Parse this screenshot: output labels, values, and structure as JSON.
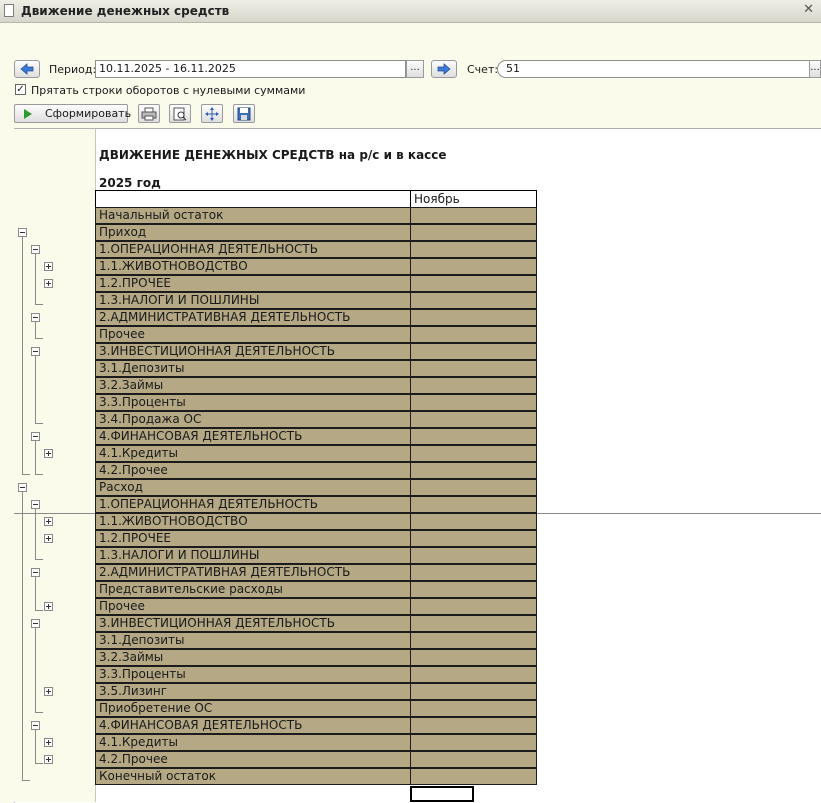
{
  "window": {
    "title": "Движение денежных средств"
  },
  "toolbar": {
    "period_label": "Период:",
    "period_value": "10.11.2025 - 16.11.2025",
    "account_label": "Счет:",
    "account_value": "51",
    "ellipsis": "...",
    "hide_zero_label": "Прятать строки оборотов с нулевыми суммами",
    "hide_zero_checked": true,
    "generate_label": "Сформировать"
  },
  "report": {
    "title": "ДВИЖЕНИЕ ДЕНЕЖНЫХ СРЕДСТВ на р/с и в кассе",
    "year": "2025 год",
    "column_header": "Ноябрь",
    "rows": [
      {
        "label": "Начальный остаток",
        "value": ""
      },
      {
        "label": "Приход",
        "value": ""
      },
      {
        "label": "1.ОПЕРАЦИОННАЯ ДЕЯТЕЛЬНОСТЬ",
        "value": ""
      },
      {
        "label": "1.1.ЖИВОТНОВОДСТВО",
        "value": ""
      },
      {
        "label": "1.2.ПРОЧЕЕ",
        "value": ""
      },
      {
        "label": "1.3.НАЛОГИ И ПОШЛИНЫ",
        "value": ""
      },
      {
        "label": "2.АДМИНИСТРАТИВНАЯ ДЕЯТЕЛЬНОСТЬ",
        "value": ""
      },
      {
        "label": "Прочее",
        "value": ""
      },
      {
        "label": "3.ИНВЕСТИЦИОННАЯ ДЕЯТЕЛЬНОСТЬ",
        "value": ""
      },
      {
        "label": "3.1.Депозиты",
        "value": ""
      },
      {
        "label": "3.2.Займы",
        "value": ""
      },
      {
        "label": "3.3.Проценты",
        "value": ""
      },
      {
        "label": "3.4.Продажа ОС",
        "value": ""
      },
      {
        "label": "4.ФИНАНСОВАЯ ДЕЯТЕЛЬНОСТЬ",
        "value": ""
      },
      {
        "label": "4.1.Кредиты",
        "value": ""
      },
      {
        "label": "4.2.Прочее",
        "value": ""
      },
      {
        "label": "Расход",
        "value": ""
      },
      {
        "label": "1.ОПЕРАЦИОННАЯ ДЕЯТЕЛЬНОСТЬ",
        "value": ""
      },
      {
        "label": "1.1.ЖИВОТНОВОДСТВО",
        "value": ""
      },
      {
        "label": "1.2.ПРОЧЕЕ",
        "value": ""
      },
      {
        "label": "1.3.НАЛОГИ И ПОШЛИНЫ",
        "value": ""
      },
      {
        "label": "2.АДМИНИСТРАТИВНАЯ ДЕЯТЕЛЬНОСТЬ",
        "value": ""
      },
      {
        "label": "Представительские расходы",
        "value": ""
      },
      {
        "label": "Прочее",
        "value": ""
      },
      {
        "label": "3.ИНВЕСТИЦИОННАЯ ДЕЯТЕЛЬНОСТЬ",
        "value": ""
      },
      {
        "label": "3.1.Депозиты",
        "value": ""
      },
      {
        "label": "3.2.Займы",
        "value": ""
      },
      {
        "label": "3.3.Проценты",
        "value": ""
      },
      {
        "label": "3.5.Лизинг",
        "value": ""
      },
      {
        "label": "Приобретение ОС",
        "value": ""
      },
      {
        "label": "4.ФИНАНСОВАЯ ДЕЯТЕЛЬНОСТЬ",
        "value": ""
      },
      {
        "label": "4.1.Кредиты",
        "value": ""
      },
      {
        "label": "4.2.Прочее",
        "value": ""
      },
      {
        "label": "Конечный остаток",
        "value": ""
      }
    ]
  },
  "colors": {
    "row_fill": "#b4a984",
    "window_bg": "#fbfbeb"
  }
}
